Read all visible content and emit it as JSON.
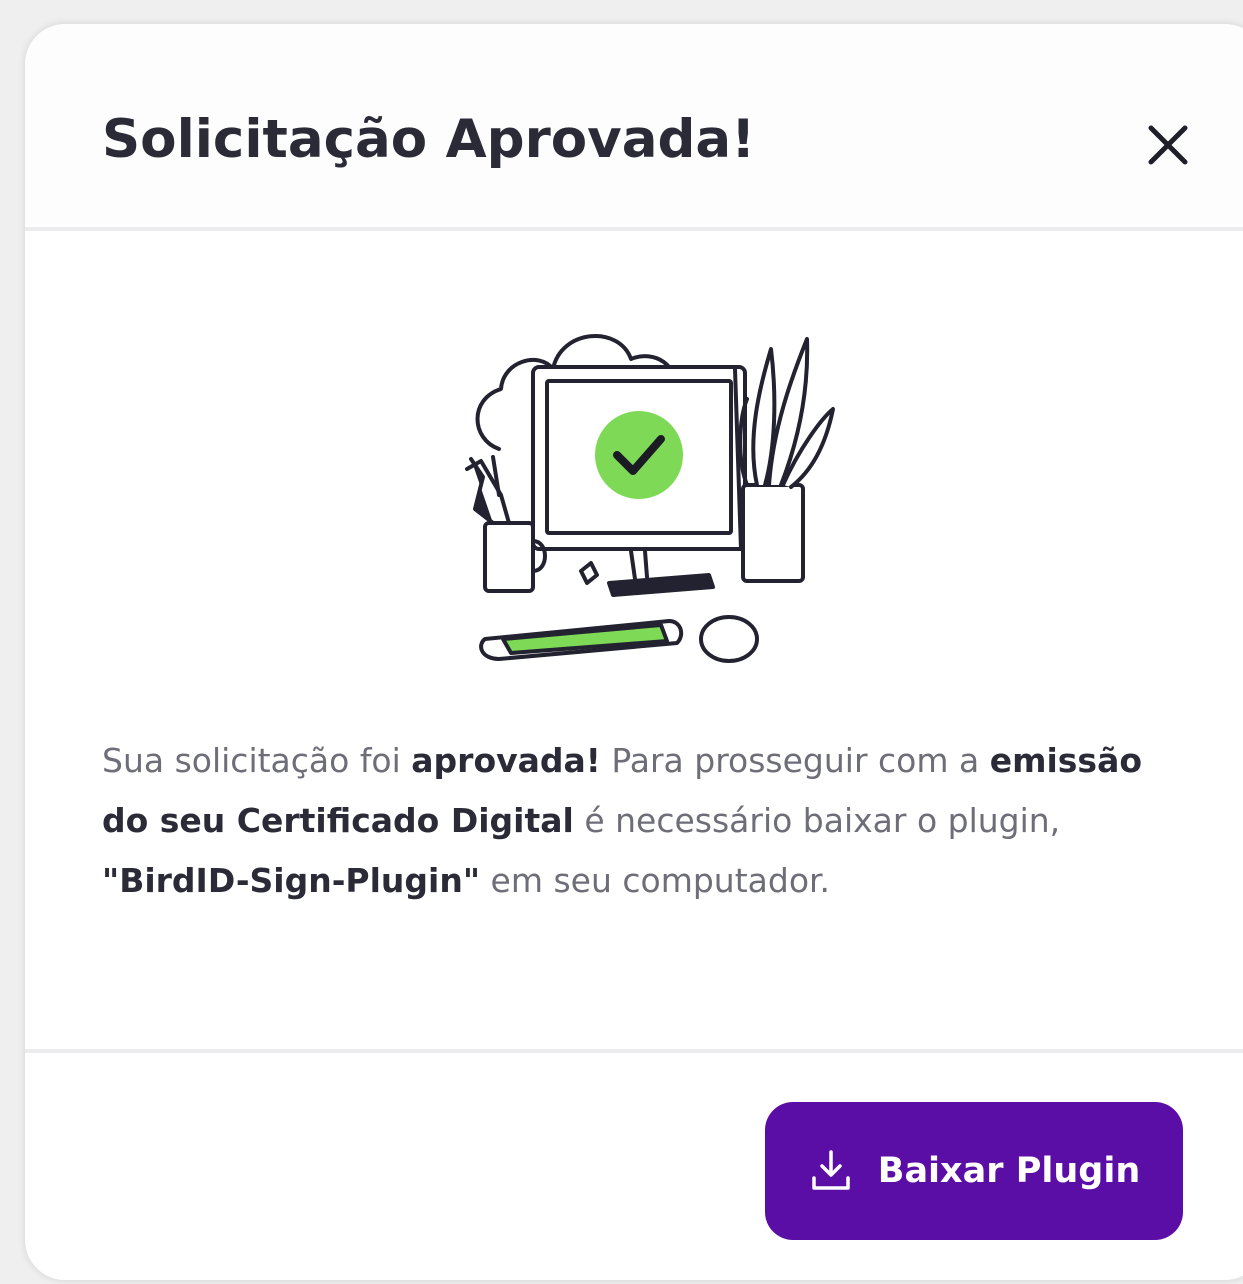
{
  "dialog": {
    "title": "Solicitação Aprovada!",
    "close_icon": "close-icon"
  },
  "body": {
    "illustration": "computer-approved-illustration",
    "message": {
      "part1": "Sua solicitação foi ",
      "bold1": "aprovada!",
      "part2": " Para prosseguir com a ",
      "bold2": "emissão do seu Certificado Digital",
      "part3": " é necessário baixar o plugin, ",
      "bold3": "\"BirdID-Sign-Plugin\"",
      "part4": " em seu computador."
    }
  },
  "footer": {
    "download_label": "Baixar Plugin",
    "download_icon": "download-icon"
  },
  "colors": {
    "primary": "#5b0ea6",
    "accent_green": "#7ed957",
    "title_text": "#2b2b38",
    "body_text": "#6e6e78"
  }
}
